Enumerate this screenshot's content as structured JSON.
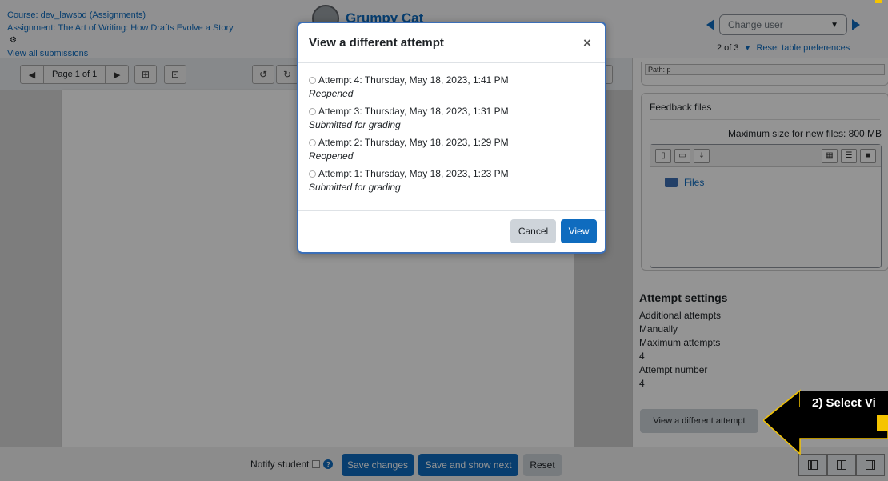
{
  "header": {
    "course_link": "Course: dev_lawsbd (Assignments)",
    "assignment_link": "Assignment: The Art of Writing: How Drafts Evolve a Story",
    "view_all_link": "View all submissions",
    "student_name": "Grumpy Cat",
    "change_user_placeholder": "Change user",
    "user_count": "2 of 3",
    "reset_table": "Reset table preferences"
  },
  "toolbar": {
    "page_label": "Page 1 of 1"
  },
  "right_panel": {
    "path_text": "Path: p",
    "feedback_files_title": "Feedback files",
    "max_size": "Maximum size for new files: 800 MB",
    "files_folder": "Files",
    "attempt_settings_title": "Attempt settings",
    "settings": [
      "Additional attempts",
      "Manually",
      "Maximum attempts",
      "4",
      "Attempt number",
      "4"
    ],
    "view_different_attempt": "View a different attempt"
  },
  "bottom": {
    "notify_student": "Notify student",
    "save_changes": "Save changes",
    "save_and_show_next": "Save and show next",
    "reset": "Reset"
  },
  "annotation": {
    "label": "2) Select Vi"
  },
  "modal": {
    "title": "View a different attempt",
    "attempts": [
      {
        "label": "Attempt 4: Thursday, May 18, 2023, 1:41 PM",
        "status": "Reopened"
      },
      {
        "label": "Attempt 3: Thursday, May 18, 2023, 1:31 PM",
        "status": "Submitted for grading"
      },
      {
        "label": "Attempt 2: Thursday, May 18, 2023, 1:29 PM",
        "status": "Reopened"
      },
      {
        "label": "Attempt 1: Thursday, May 18, 2023, 1:23 PM",
        "status": "Submitted for grading"
      }
    ],
    "cancel_label": "Cancel",
    "view_label": "View"
  },
  "colors": {
    "primary": "#0f6cbf",
    "modal_border": "#3b6fb8",
    "callout_yellow": "#f5c400"
  }
}
